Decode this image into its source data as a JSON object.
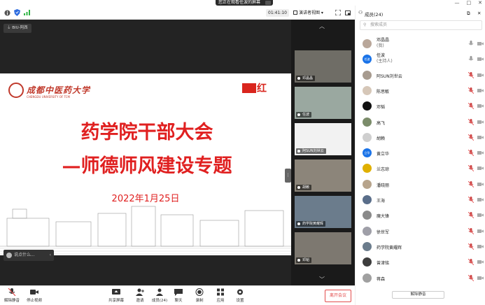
{
  "top": {
    "share_banner": "您正在观看任波的屏幕",
    "window_controls": [
      "—",
      "□",
      "✕"
    ]
  },
  "toolbar": {
    "timer": "01:41:10",
    "view_mode": "演讲者视图"
  },
  "stage": {
    "mic_tag": "BIU-阿西",
    "slide": {
      "school_cn": "成都中医药大学",
      "school_en": "CHENGDU UNIVERSITY OF TCM",
      "flag_text": "红",
      "title": "药学院干部大会",
      "subtitle": "—师德师风建设专题",
      "date": "2022年1月25日"
    },
    "comment_placeholder": "说点什么..."
  },
  "filmstrip": {
    "thumbs": [
      {
        "name": "邓晶晶",
        "bg": "#6f6d66"
      },
      {
        "name": "任波",
        "bg": "#9aa8a0"
      },
      {
        "name": "阿SUN刘世云",
        "bg": "#f2f2f2"
      },
      {
        "name": "胡赖",
        "bg": "#8c857a"
      },
      {
        "name": "药学院黄耀辉",
        "bg": "#6b7c8c"
      },
      {
        "name": "邓韬",
        "bg": "#7d7870"
      }
    ]
  },
  "bottombar": {
    "items": [
      {
        "label": "解除静音"
      },
      {
        "label": "停止视频"
      },
      {
        "label": "共享屏幕"
      },
      {
        "label": "邀请"
      },
      {
        "label": "成员(24)"
      },
      {
        "label": "聊天"
      },
      {
        "label": "录制"
      },
      {
        "label": "应用"
      },
      {
        "label": "设置"
      }
    ],
    "end_meeting": "离开会议"
  },
  "panel": {
    "title": "成员(24)",
    "search_placeholder": "搜索成员",
    "unmute_all": "解除静音",
    "members": [
      {
        "name": "邓晶晶",
        "role": "(我)",
        "avatar": "",
        "avatar_color": "#b9a79a"
      },
      {
        "name": "任波",
        "role": "(主持人)",
        "avatar": "任波",
        "avatar_color": "#1a73e8"
      },
      {
        "name": "阿SUN刘世云",
        "role": "",
        "avatar": "",
        "avatar_color": "#a79b8f"
      },
      {
        "name": "陈思敏",
        "role": "",
        "avatar": "",
        "avatar_color": "#d6c7b8"
      },
      {
        "name": "邓韬",
        "role": "",
        "avatar": "",
        "avatar_color": "#111111"
      },
      {
        "name": "高飞",
        "role": "",
        "avatar": "",
        "avatar_color": "#7b8c6a"
      },
      {
        "name": "胡赖",
        "role": "",
        "avatar": "",
        "avatar_color": "#cfcfcf"
      },
      {
        "name": "黄立华",
        "role": "",
        "avatar": "立华",
        "avatar_color": "#1a73e8"
      },
      {
        "name": "兰志琼",
        "role": "",
        "avatar": "",
        "avatar_color": "#e0b000"
      },
      {
        "name": "潘晓丽",
        "role": "",
        "avatar": "",
        "avatar_color": "#b7a48c"
      },
      {
        "name": "王海",
        "role": "",
        "avatar": "",
        "avatar_color": "#5a6e8a"
      },
      {
        "name": "魔大锋",
        "role": "",
        "avatar": "",
        "avatar_color": "#8a8a8a"
      },
      {
        "name": "徐世军",
        "role": "",
        "avatar": "",
        "avatar_color": "#9f9fa8"
      },
      {
        "name": "药学院黄耀辉",
        "role": "",
        "avatar": "",
        "avatar_color": "#6b7c8c"
      },
      {
        "name": "曾津铭",
        "role": "",
        "avatar": "",
        "avatar_color": "#3d3d3d"
      },
      {
        "name": "蒋森",
        "role": "",
        "avatar": "",
        "avatar_color": "#a0a0a0"
      }
    ]
  }
}
